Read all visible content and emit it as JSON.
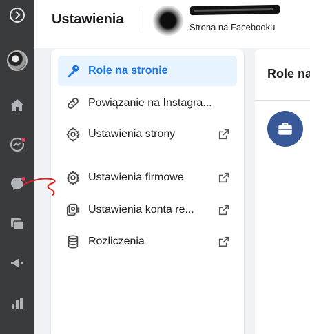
{
  "header": {
    "title": "Ustawienia",
    "page_subtitle": "Strona na Facebooku"
  },
  "rail": {
    "icons": [
      "logo-icon",
      "avatar",
      "home-icon",
      "messenger-notifications-icon",
      "chat-icon",
      "pages-icon",
      "megaphone-icon",
      "insights-icon"
    ]
  },
  "menu": {
    "items": [
      {
        "label": "Role na stronie",
        "icon": "key-icon",
        "active": true,
        "external": false
      },
      {
        "label": "Powiązanie na Instagra...",
        "icon": "link-icon",
        "active": false,
        "external": false
      },
      {
        "label": "Ustawienia strony",
        "icon": "gear-icon",
        "active": false,
        "external": true
      },
      {
        "label": "Ustawienia firmowe",
        "icon": "gear-icon",
        "active": false,
        "external": true
      },
      {
        "label": "Ustawienia konta re...",
        "icon": "ads-account-icon",
        "active": false,
        "external": true
      },
      {
        "label": "Rozliczenia",
        "icon": "billing-icon",
        "active": false,
        "external": true
      }
    ]
  },
  "content": {
    "title": "Role na"
  },
  "colors": {
    "accent": "#1877f2",
    "active_bg": "#e7f3ff",
    "rail_bg": "#3a3b3c",
    "notification": "#e4405f",
    "annotation": "#e02020"
  }
}
